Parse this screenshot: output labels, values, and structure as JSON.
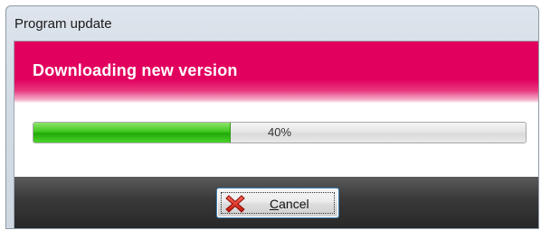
{
  "window": {
    "title": "Program update"
  },
  "header": {
    "title": "Downloading new version",
    "accent_color": "#e2005f"
  },
  "progress": {
    "percent": 40,
    "label": "40%",
    "fill_color": "#3fc71e"
  },
  "buttons": {
    "cancel": {
      "label_mnemonic": "C",
      "label_rest": "ancel",
      "icon": "red-x-icon"
    }
  }
}
